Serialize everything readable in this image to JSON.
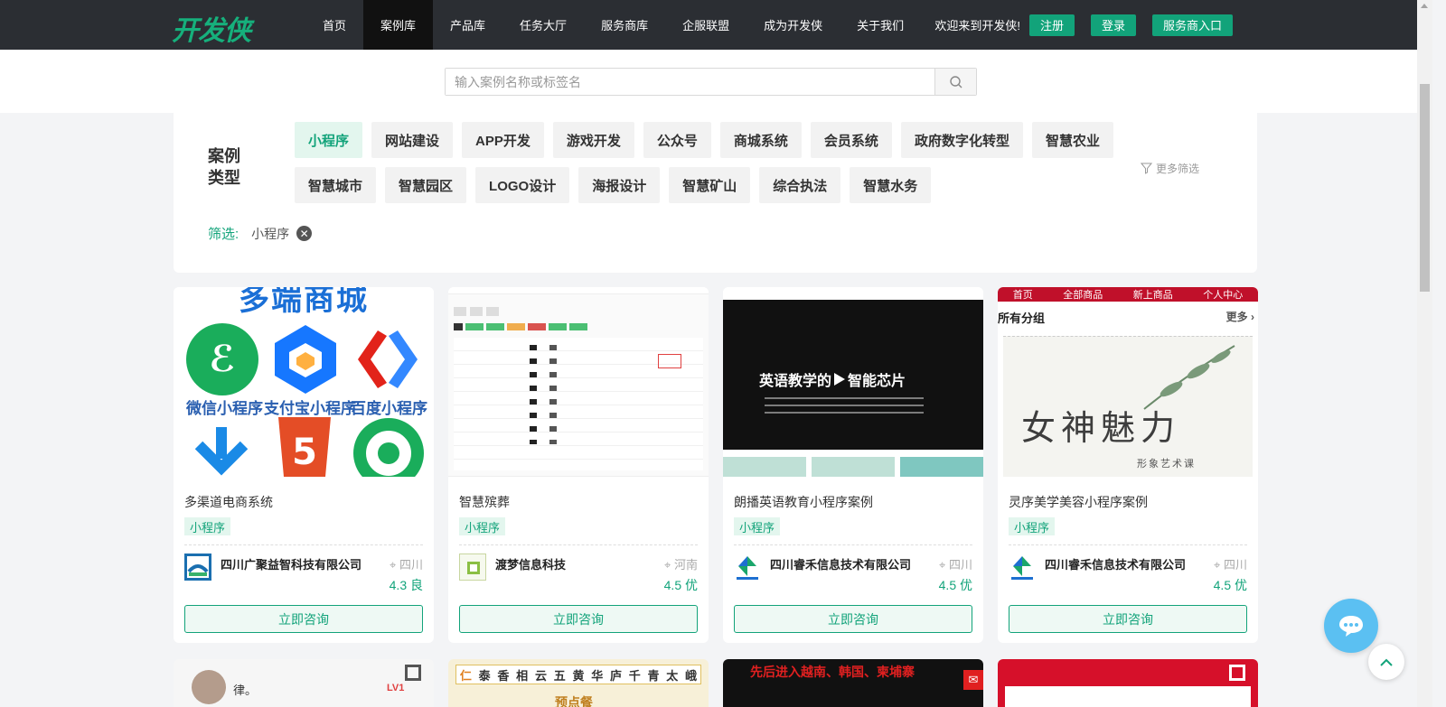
{
  "nav": {
    "logo": "开发侠",
    "menu": [
      "首页",
      "案例库",
      "产品库",
      "任务大厅",
      "服务商库",
      "企服联盟",
      "成为开发侠",
      "关于我们"
    ],
    "active_index": 1,
    "welcome": "欢迎来到开发侠!",
    "register": "注册",
    "login": "登录",
    "provider_entry": "服务商入口"
  },
  "search": {
    "placeholder": "输入案例名称或标签名"
  },
  "filter": {
    "label": "案例类型",
    "tags": [
      "小程序",
      "网站建设",
      "APP开发",
      "游戏开发",
      "公众号",
      "商城系统",
      "会员系统",
      "政府数字化转型",
      "智慧农业",
      "智慧城市",
      "智慧园区",
      "LOGO设计",
      "海报设计",
      "智慧矿山",
      "综合执法",
      "智慧水务"
    ],
    "active_tag": 0,
    "more": "更多筛选",
    "applied_label": "筛选:",
    "applied_value": "小程序"
  },
  "cards": [
    {
      "title": "多渠道电商系统",
      "tag": "小程序",
      "company": "四川广聚益智科技有限公司",
      "location": "四川",
      "rating": "4.3 良",
      "button": "立即咨询",
      "thumb": {
        "heading": "多端商城",
        "apps": [
          "微信小程序",
          "支付宝小程序",
          "百度小程序"
        ]
      }
    },
    {
      "title": "智慧殡葬",
      "tag": "小程序",
      "company": "渡梦信息科技",
      "location": "河南",
      "rating": "4.5 优",
      "button": "立即咨询"
    },
    {
      "title": "朗播英语教育小程序案例",
      "tag": "小程序",
      "company": "四川睿禾信息技术有限公司",
      "location": "四川",
      "rating": "4.5 优",
      "button": "立即咨询",
      "thumb": {
        "heading": "英语教学的",
        "heading2": "智能芯片"
      }
    },
    {
      "title": "灵序美学美容小程序案例",
      "tag": "小程序",
      "company": "四川睿禾信息技术有限公司",
      "location": "四川",
      "rating": "4.5 优",
      "button": "立即咨询",
      "thumb": {
        "tabs": [
          "首页",
          "全部商品",
          "新上商品",
          "个人中心"
        ],
        "group": "所有分组",
        "more": "更多",
        "brand": "女神魅力",
        "sub": "形象艺术课"
      }
    }
  ],
  "row2": [
    {
      "name": "律。",
      "badge": "LV1"
    },
    {
      "chars": [
        "仁",
        "泰",
        "香",
        "相",
        "云",
        "五",
        "黄",
        "华",
        "庐",
        "千",
        "青",
        "太",
        "峨"
      ],
      "sign": "预点餐"
    },
    {
      "text": "先后进入越南、韩国、柬埔寨"
    },
    {}
  ],
  "colors": {
    "accent": "#12a37a",
    "nav_bg": "#2b2e33",
    "chat": "#5bc0f2"
  }
}
